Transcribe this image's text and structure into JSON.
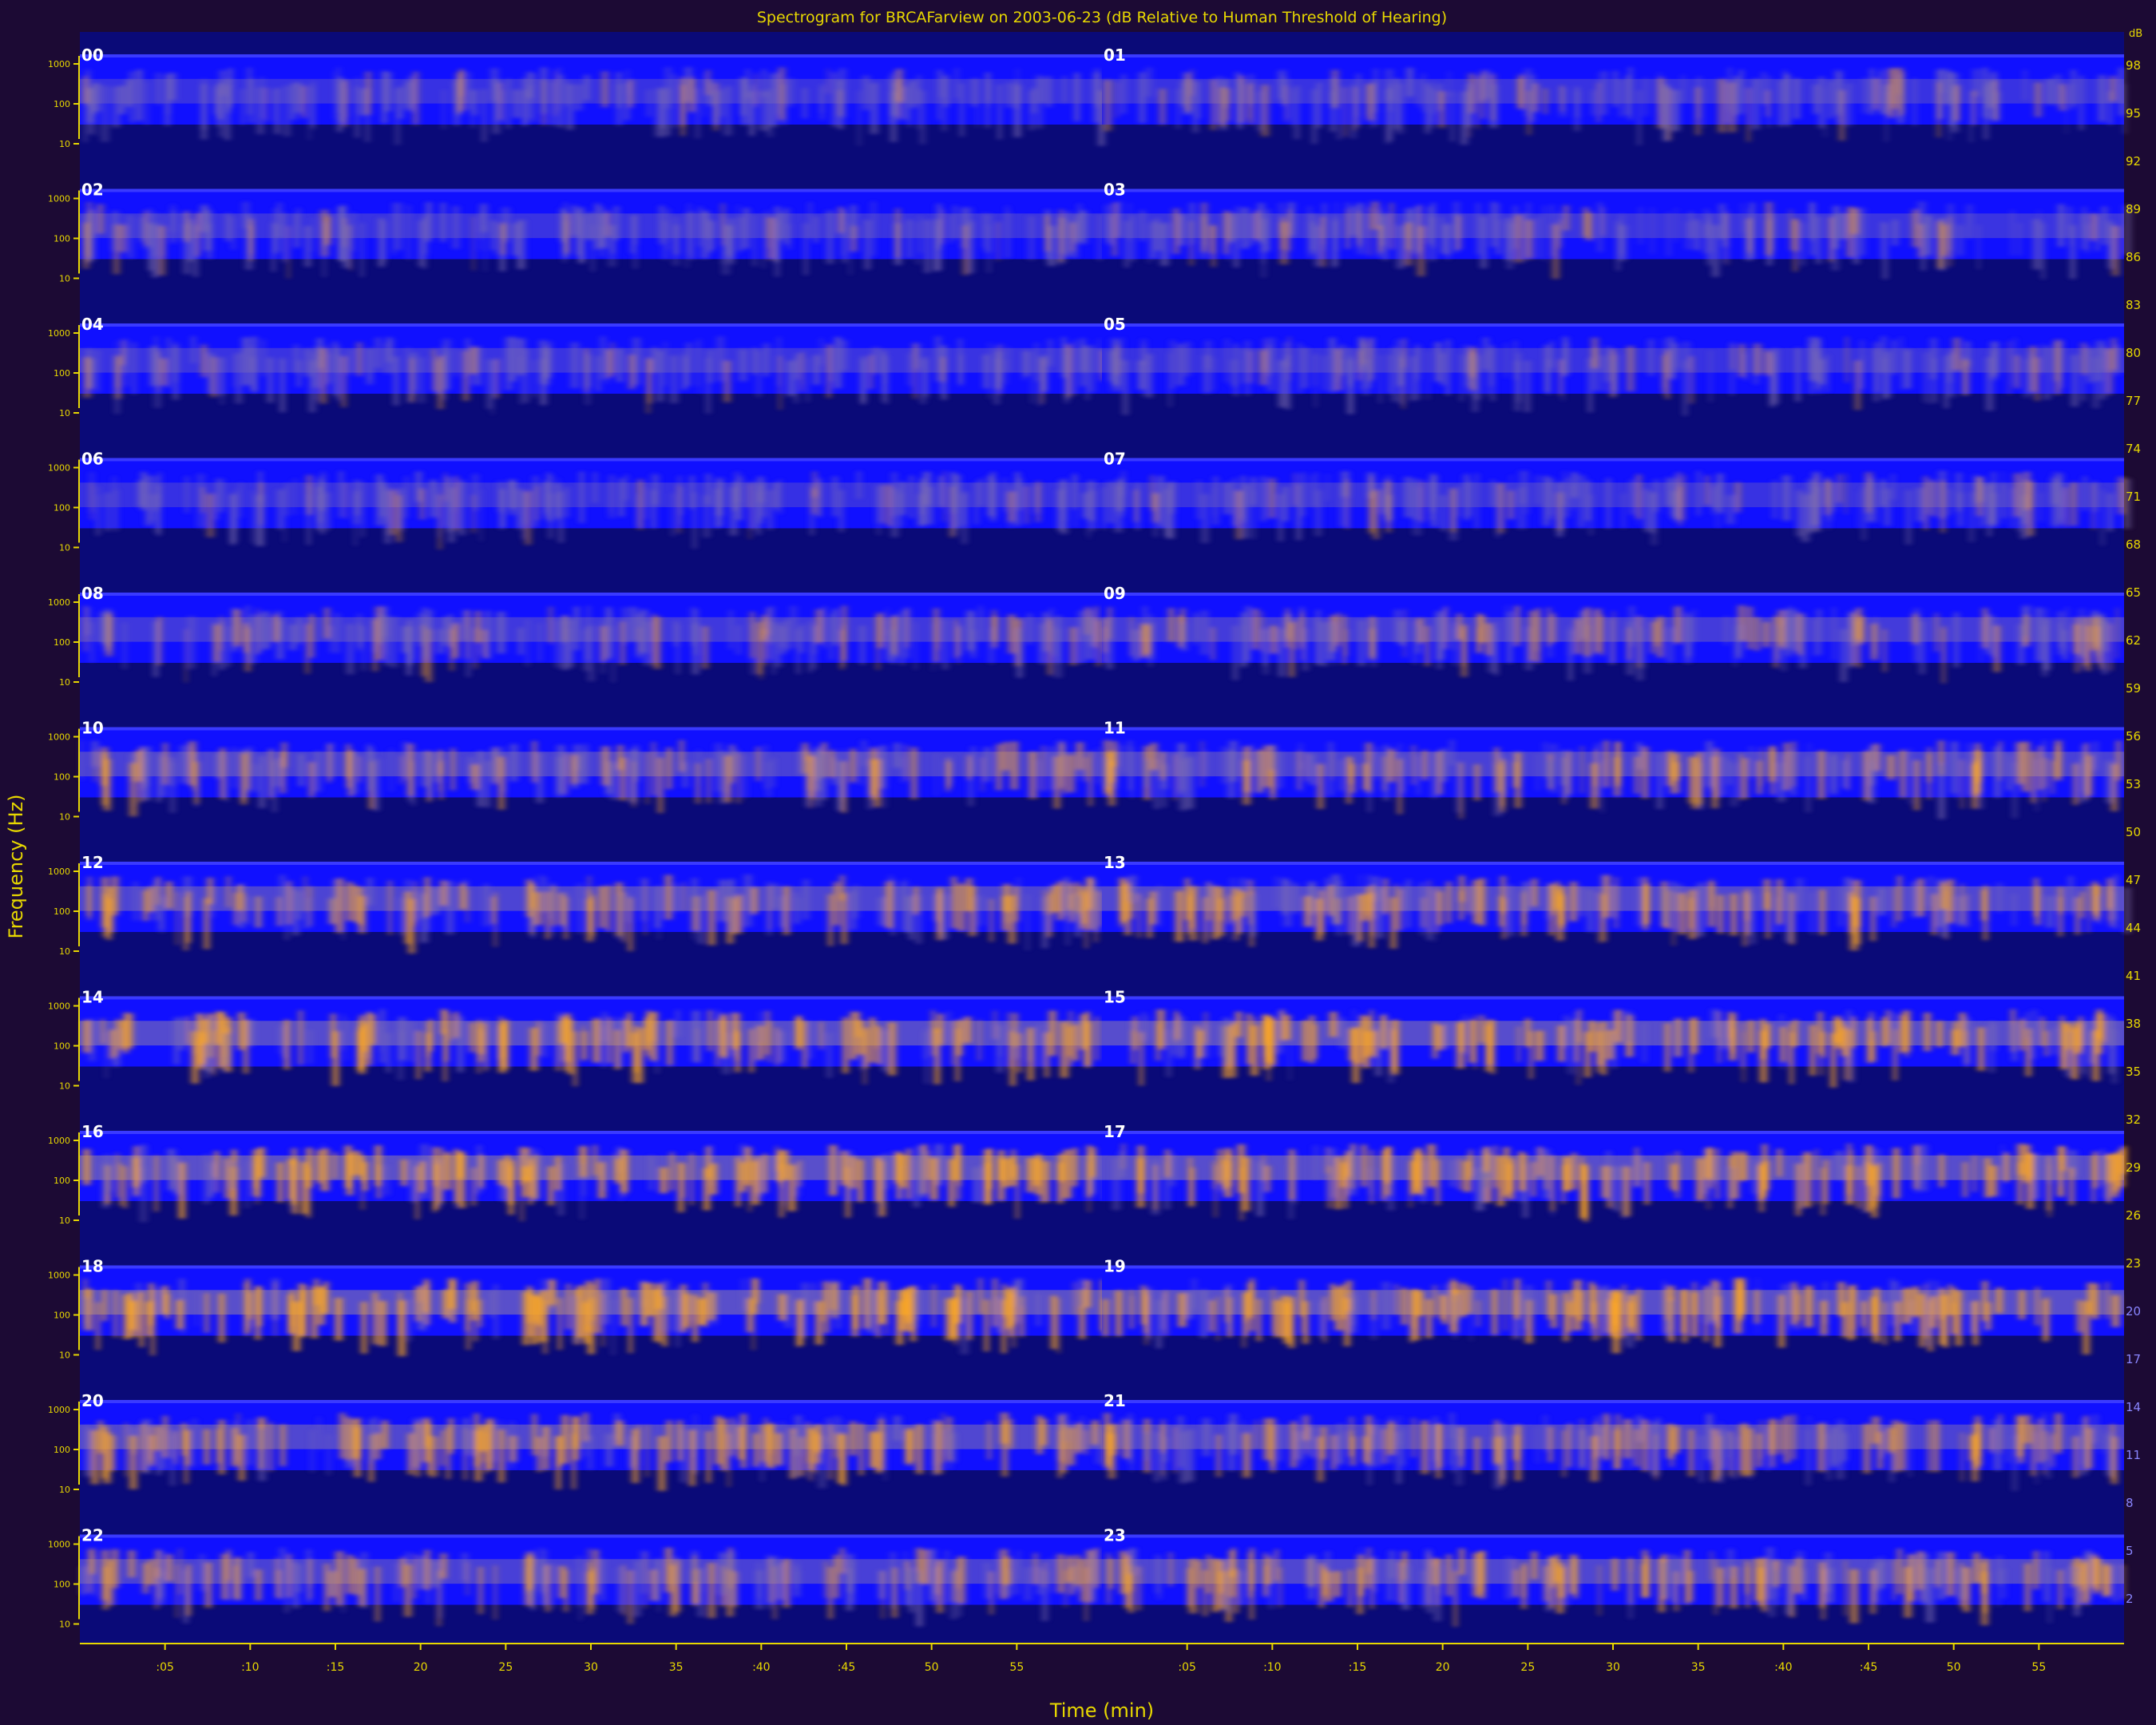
{
  "chart_data": {
    "type": "heatmap",
    "title": "Spectrogram for BRCAFarview on 2003-06-23 (dB Relative to Human Threshold of Hearing)",
    "xlabel": "Time (min)",
    "ylabel": "Frequency (Hz)",
    "panels": [
      {
        "label": "00",
        "intensity": 0.18
      },
      {
        "label": "01",
        "intensity": 0.2
      },
      {
        "label": "02",
        "intensity": 0.22
      },
      {
        "label": "03",
        "intensity": 0.24
      },
      {
        "label": "04",
        "intensity": 0.22
      },
      {
        "label": "05",
        "intensity": 0.2
      },
      {
        "label": "06",
        "intensity": 0.16
      },
      {
        "label": "07",
        "intensity": 0.2
      },
      {
        "label": "08",
        "intensity": 0.3
      },
      {
        "label": "09",
        "intensity": 0.38
      },
      {
        "label": "10",
        "intensity": 0.45
      },
      {
        "label": "11",
        "intensity": 0.48
      },
      {
        "label": "12",
        "intensity": 0.52
      },
      {
        "label": "13",
        "intensity": 0.56
      },
      {
        "label": "14",
        "intensity": 0.66
      },
      {
        "label": "15",
        "intensity": 0.7
      },
      {
        "label": "16",
        "intensity": 0.74
      },
      {
        "label": "17",
        "intensity": 0.7
      },
      {
        "label": "18",
        "intensity": 0.74
      },
      {
        "label": "19",
        "intensity": 0.72
      },
      {
        "label": "20",
        "intensity": 0.6
      },
      {
        "label": "21",
        "intensity": 0.5
      },
      {
        "label": "22",
        "intensity": 0.48
      },
      {
        "label": "23",
        "intensity": 0.58
      }
    ],
    "freq_ticks": [
      "1000",
      "100",
      "10"
    ],
    "time_ticks": [
      ":05",
      ":10",
      ":15",
      "20",
      "25",
      "30",
      "35",
      ":40",
      ":45",
      "50",
      "55"
    ],
    "colorbar_ticks": [
      "98",
      "95",
      "92",
      "89",
      "86",
      "83",
      "80",
      "77",
      "74",
      "71",
      "68",
      "65",
      "62",
      "59",
      "56",
      "53",
      "50",
      "47",
      "44",
      "41",
      "38",
      "35",
      "32",
      "29",
      "26",
      "23",
      "20",
      "17",
      "14",
      "11",
      "8",
      "5",
      "2"
    ],
    "colorbar_top_label": "dB",
    "colors": {
      "background": "#1c0a34",
      "plot_background": "#0a0a78",
      "low": "#1010ff",
      "mid": "#8070b0",
      "high": "#ffa820",
      "axis": "#e8d800",
      "text": "#ffffff"
    }
  }
}
